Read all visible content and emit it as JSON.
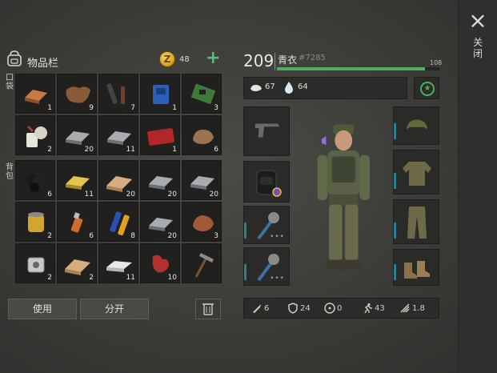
{
  "close": {
    "label": "关闭"
  },
  "inventory": {
    "title": "物品栏",
    "coins": "48",
    "pocket_label": "口袋",
    "backpack_label": "背包",
    "cells": [
      {
        "item": "copper-bar",
        "qty": "1"
      },
      {
        "item": "leather",
        "qty": "9"
      },
      {
        "item": "tool-parts",
        "qty": "7"
      },
      {
        "item": "blue-chip",
        "qty": "1"
      },
      {
        "item": "circuit-board",
        "qty": "3"
      },
      {
        "item": "cloth-bandage",
        "qty": "2"
      },
      {
        "item": "iron-bar",
        "qty": "20"
      },
      {
        "item": "iron-bar",
        "qty": "11"
      },
      {
        "item": "coupon-ticket",
        "qty": "1"
      },
      {
        "item": "raw-ore",
        "qty": "6"
      },
      {
        "item": "coal",
        "qty": "6"
      },
      {
        "item": "gold-bar",
        "qty": "11"
      },
      {
        "item": "wood-plank",
        "qty": "20"
      },
      {
        "item": "iron-bar",
        "qty": "20"
      },
      {
        "item": "iron-bar",
        "qty": "20"
      },
      {
        "item": "oil-filter",
        "qty": "2"
      },
      {
        "item": "usb-drive",
        "qty": "6"
      },
      {
        "item": "batteries",
        "qty": "8"
      },
      {
        "item": "iron-bar",
        "qty": "20"
      },
      {
        "item": "copper-ore",
        "qty": "3"
      },
      {
        "item": "engine-part",
        "qty": "2"
      },
      {
        "item": "wood-plank",
        "qty": "2"
      },
      {
        "item": "stone-brick",
        "qty": "11"
      },
      {
        "item": "raw-meat",
        "qty": "10"
      },
      {
        "item": "hammer",
        "qty": ""
      }
    ],
    "buttons": {
      "use": "使用",
      "split": "分开"
    }
  },
  "character": {
    "level": "209",
    "name": "青衣",
    "id": "#7285",
    "xp_max": "108",
    "xp_fraction": 0.91,
    "food": "67",
    "water": "64"
  },
  "stats": {
    "attack": "6",
    "armor": "24",
    "radiation": "0",
    "speed": "43",
    "stamina": "1.8"
  },
  "colors": {
    "accent_green": "#4fae5a",
    "slot_accent": "#2f7f94"
  }
}
